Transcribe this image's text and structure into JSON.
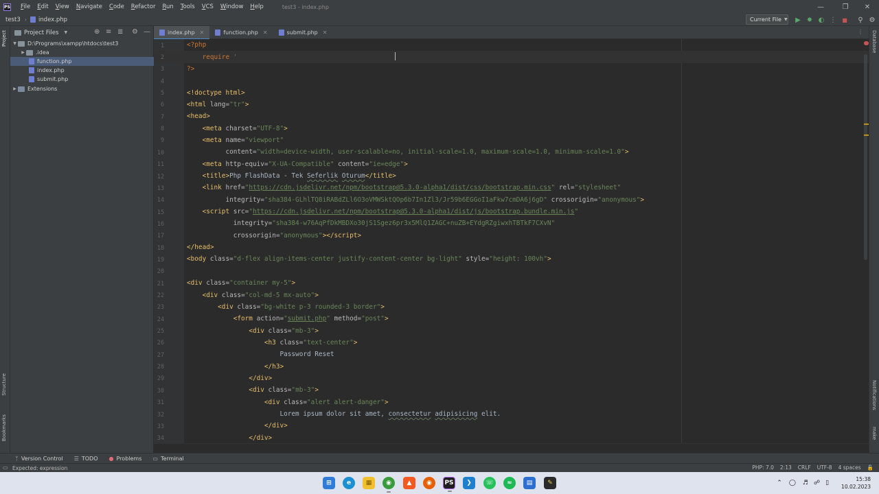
{
  "titlebar": {
    "logo": "PS",
    "menus": [
      "File",
      "Edit",
      "View",
      "Navigate",
      "Code",
      "Refactor",
      "Run",
      "Tools",
      "VCS",
      "Window",
      "Help"
    ],
    "window_title": "test3 - index.php"
  },
  "navbar": {
    "project": "test3",
    "file": "index.php",
    "run_config": "Current File"
  },
  "project_panel": {
    "title": "Project Files",
    "tree": [
      {
        "label": "D:\\Programs\\xampp\\htdocs\\test3",
        "type": "folder",
        "expanded": true
      },
      {
        "label": ".idea",
        "type": "folder",
        "expanded": false
      },
      {
        "label": "function.php",
        "type": "php",
        "selected": true
      },
      {
        "label": "index.php",
        "type": "php"
      },
      {
        "label": "submit.php",
        "type": "php"
      },
      {
        "label": "Extensions",
        "type": "lib",
        "expanded": false
      }
    ]
  },
  "side_labels": {
    "left_top": "Project",
    "left_structure": "Structure",
    "left_bookmarks": "Bookmarks",
    "right_database": "Database",
    "right_notifications": "Notifications",
    "right_make": "make"
  },
  "tabs": [
    {
      "label": "index.php",
      "active": true
    },
    {
      "label": "function.php",
      "active": false
    },
    {
      "label": "submit.php",
      "active": false
    }
  ],
  "editor": {
    "current_line": 2,
    "lines": [
      {
        "n": "1",
        "html": "<span class=\"php\">&lt;?php</span>"
      },
      {
        "n": "2",
        "html": "    <span class=\"kw\">require</span> <span class=\"str\">'</span>"
      },
      {
        "n": "3",
        "html": "<span class=\"php\">?&gt;</span>"
      },
      {
        "n": "4",
        "html": ""
      },
      {
        "n": "5",
        "html": "<span class=\"tag\">&lt;!doctype html&gt;</span>"
      },
      {
        "n": "6",
        "html": "<span class=\"tag\">&lt;html </span><span class=\"attr\">lang=</span><span class=\"str\">\"tr\"</span><span class=\"tag\">&gt;</span>"
      },
      {
        "n": "7",
        "html": "<span class=\"tag\">&lt;head&gt;</span>"
      },
      {
        "n": "8",
        "html": "    <span class=\"tag\">&lt;meta </span><span class=\"attr\">charset=</span><span class=\"str\">\"UTF-8\"</span><span class=\"tag\">&gt;</span>"
      },
      {
        "n": "9",
        "html": "    <span class=\"tag\">&lt;meta </span><span class=\"attr\">name=</span><span class=\"str\">\"viewport\"</span>"
      },
      {
        "n": "10",
        "html": "          <span class=\"attr\">content=</span><span class=\"str\">\"width=device-width, user-scalable=no, initial-scale=1.0, maximum-scale=1.0, minimum-scale=1.0\"</span><span class=\"tag\">&gt;</span>"
      },
      {
        "n": "11",
        "html": "    <span class=\"tag\">&lt;meta </span><span class=\"attr\">http-equiv=</span><span class=\"str\">\"X-UA-Compatible\"</span> <span class=\"attr\">content=</span><span class=\"str\">\"ie=edge\"</span><span class=\"tag\">&gt;</span>"
      },
      {
        "n": "12",
        "html": "    <span class=\"tag\">&lt;title&gt;</span><span class=\"txt\">Php FlashData - Tek <span class=\"typo\">Seferlik</span> <span class=\"typo\">Oturum</span></span><span class=\"tag\">&lt;/title&gt;</span>"
      },
      {
        "n": "13",
        "html": "    <span class=\"tag\">&lt;link </span><span class=\"attr\">href=</span><span class=\"str\">\"<span class=\"url\">https://cdn.jsdelivr.net/npm/bootstrap@5.3.0-alpha1/dist/css/bootstrap.min.css</span>\"</span> <span class=\"attr\">rel=</span><span class=\"str\">\"stylesheet\"</span>"
      },
      {
        "n": "14",
        "html": "          <span class=\"attr\">integrity=</span><span class=\"str\">\"sha384-GLhlTQ8iRABdZLl6O3oVMWSktQOp6b7In1Zl3/Jr59b6EGGoI1aFkw7cmDA6j6gD\"</span> <span class=\"attr\">crossorigin=</span><span class=\"str\">\"anonymous\"</span><span class=\"tag\">&gt;</span>"
      },
      {
        "n": "15",
        "html": "    <span class=\"tag\">&lt;script </span><span class=\"attr\">src=</span><span class=\"str\">\"<span class=\"url\">https://cdn.jsdelivr.net/npm/bootstrap@5.3.0-alpha1/dist/js/bootstrap.bundle.min.js</span>\"</span>"
      },
      {
        "n": "16",
        "html": "            <span class=\"attr\">integrity=</span><span class=\"str\">\"sha384-w76AqPfDkMBDXo30jS1Sgez6pr3x5MlQ1ZAGC+nuZB+EYdgRZgiwxhTBTkF7CXvN\"</span>"
      },
      {
        "n": "17",
        "html": "            <span class=\"attr\">crossorigin=</span><span class=\"str\">\"anonymous\"</span><span class=\"tag\">&gt;&lt;/script&gt;</span>"
      },
      {
        "n": "18",
        "html": "<span class=\"tag\">&lt;/head&gt;</span>"
      },
      {
        "n": "19",
        "html": "<span class=\"tag\">&lt;body </span><span class=\"attr\">class=</span><span class=\"str\">\"d-flex align-items-center justify-content-center bg-light\"</span> <span class=\"attr\">style=</span><span class=\"str\">\"height: 100vh\"</span><span class=\"tag\">&gt;</span>"
      },
      {
        "n": "20",
        "html": ""
      },
      {
        "n": "21",
        "html": "<span class=\"tag\">&lt;div </span><span class=\"attr\">class=</span><span class=\"str\">\"container my-5\"</span><span class=\"tag\">&gt;</span>"
      },
      {
        "n": "22",
        "html": "    <span class=\"tag\">&lt;div </span><span class=\"attr\">class=</span><span class=\"str\">\"col-md-5 mx-auto\"</span><span class=\"tag\">&gt;</span>"
      },
      {
        "n": "23",
        "html": "        <span class=\"tag\">&lt;div </span><span class=\"attr\">class=</span><span class=\"str\">\"bg-white p-3 rounded-3 border\"</span><span class=\"tag\">&gt;</span>"
      },
      {
        "n": "24",
        "html": "            <span class=\"tag\">&lt;form </span><span class=\"attr\">action=</span><span class=\"str\">\"<span class=\"url\">submit.php</span>\"</span> <span class=\"attr\">method=</span><span class=\"str\">\"post\"</span><span class=\"tag\">&gt;</span>"
      },
      {
        "n": "25",
        "html": "                <span class=\"tag\">&lt;div </span><span class=\"attr\">class=</span><span class=\"str\">\"mb-3\"</span><span class=\"tag\">&gt;</span>"
      },
      {
        "n": "26",
        "html": "                    <span class=\"tag\">&lt;h3 </span><span class=\"attr\">class=</span><span class=\"str\">\"text-center\"</span><span class=\"tag\">&gt;</span>"
      },
      {
        "n": "27",
        "html": "                        <span class=\"txt\">Password Reset</span>"
      },
      {
        "n": "28",
        "html": "                    <span class=\"tag\">&lt;/h3&gt;</span>"
      },
      {
        "n": "29",
        "html": "                <span class=\"tag\">&lt;/div&gt;</span>"
      },
      {
        "n": "30",
        "html": "                <span class=\"tag\">&lt;div </span><span class=\"attr\">class=</span><span class=\"str\">\"mb-3\"</span><span class=\"tag\">&gt;</span>"
      },
      {
        "n": "31",
        "html": "                    <span class=\"tag\">&lt;div </span><span class=\"attr\">class=</span><span class=\"str\">\"alert alert-danger\"</span><span class=\"tag\">&gt;</span>"
      },
      {
        "n": "32",
        "html": "                        <span class=\"txt\">Lorem ipsum dolor sit amet, <span class=\"typo\">consectetur</span> <span class=\"typo\">adipisicing</span> elit.</span>"
      },
      {
        "n": "33",
        "html": "                    <span class=\"tag\">&lt;/div&gt;</span>"
      },
      {
        "n": "34",
        "html": "                <span class=\"tag\">&lt;/div&gt;</span>"
      }
    ]
  },
  "bottom_bar": {
    "items": [
      {
        "label": "Version Control",
        "icon": "branch-icon"
      },
      {
        "label": "TODO",
        "icon": "list-icon"
      },
      {
        "label": "Problems",
        "icon": "error-icon"
      },
      {
        "label": "Terminal",
        "icon": "terminal-icon"
      }
    ]
  },
  "status_bar": {
    "message": "Expected: expression",
    "php_version": "PHP: 7.0",
    "position": "2:13",
    "line_sep": "CRLF",
    "encoding": "UTF-8",
    "indent": "4 spaces"
  },
  "taskbar": {
    "time": "15:38",
    "date": "10.02.2023"
  }
}
